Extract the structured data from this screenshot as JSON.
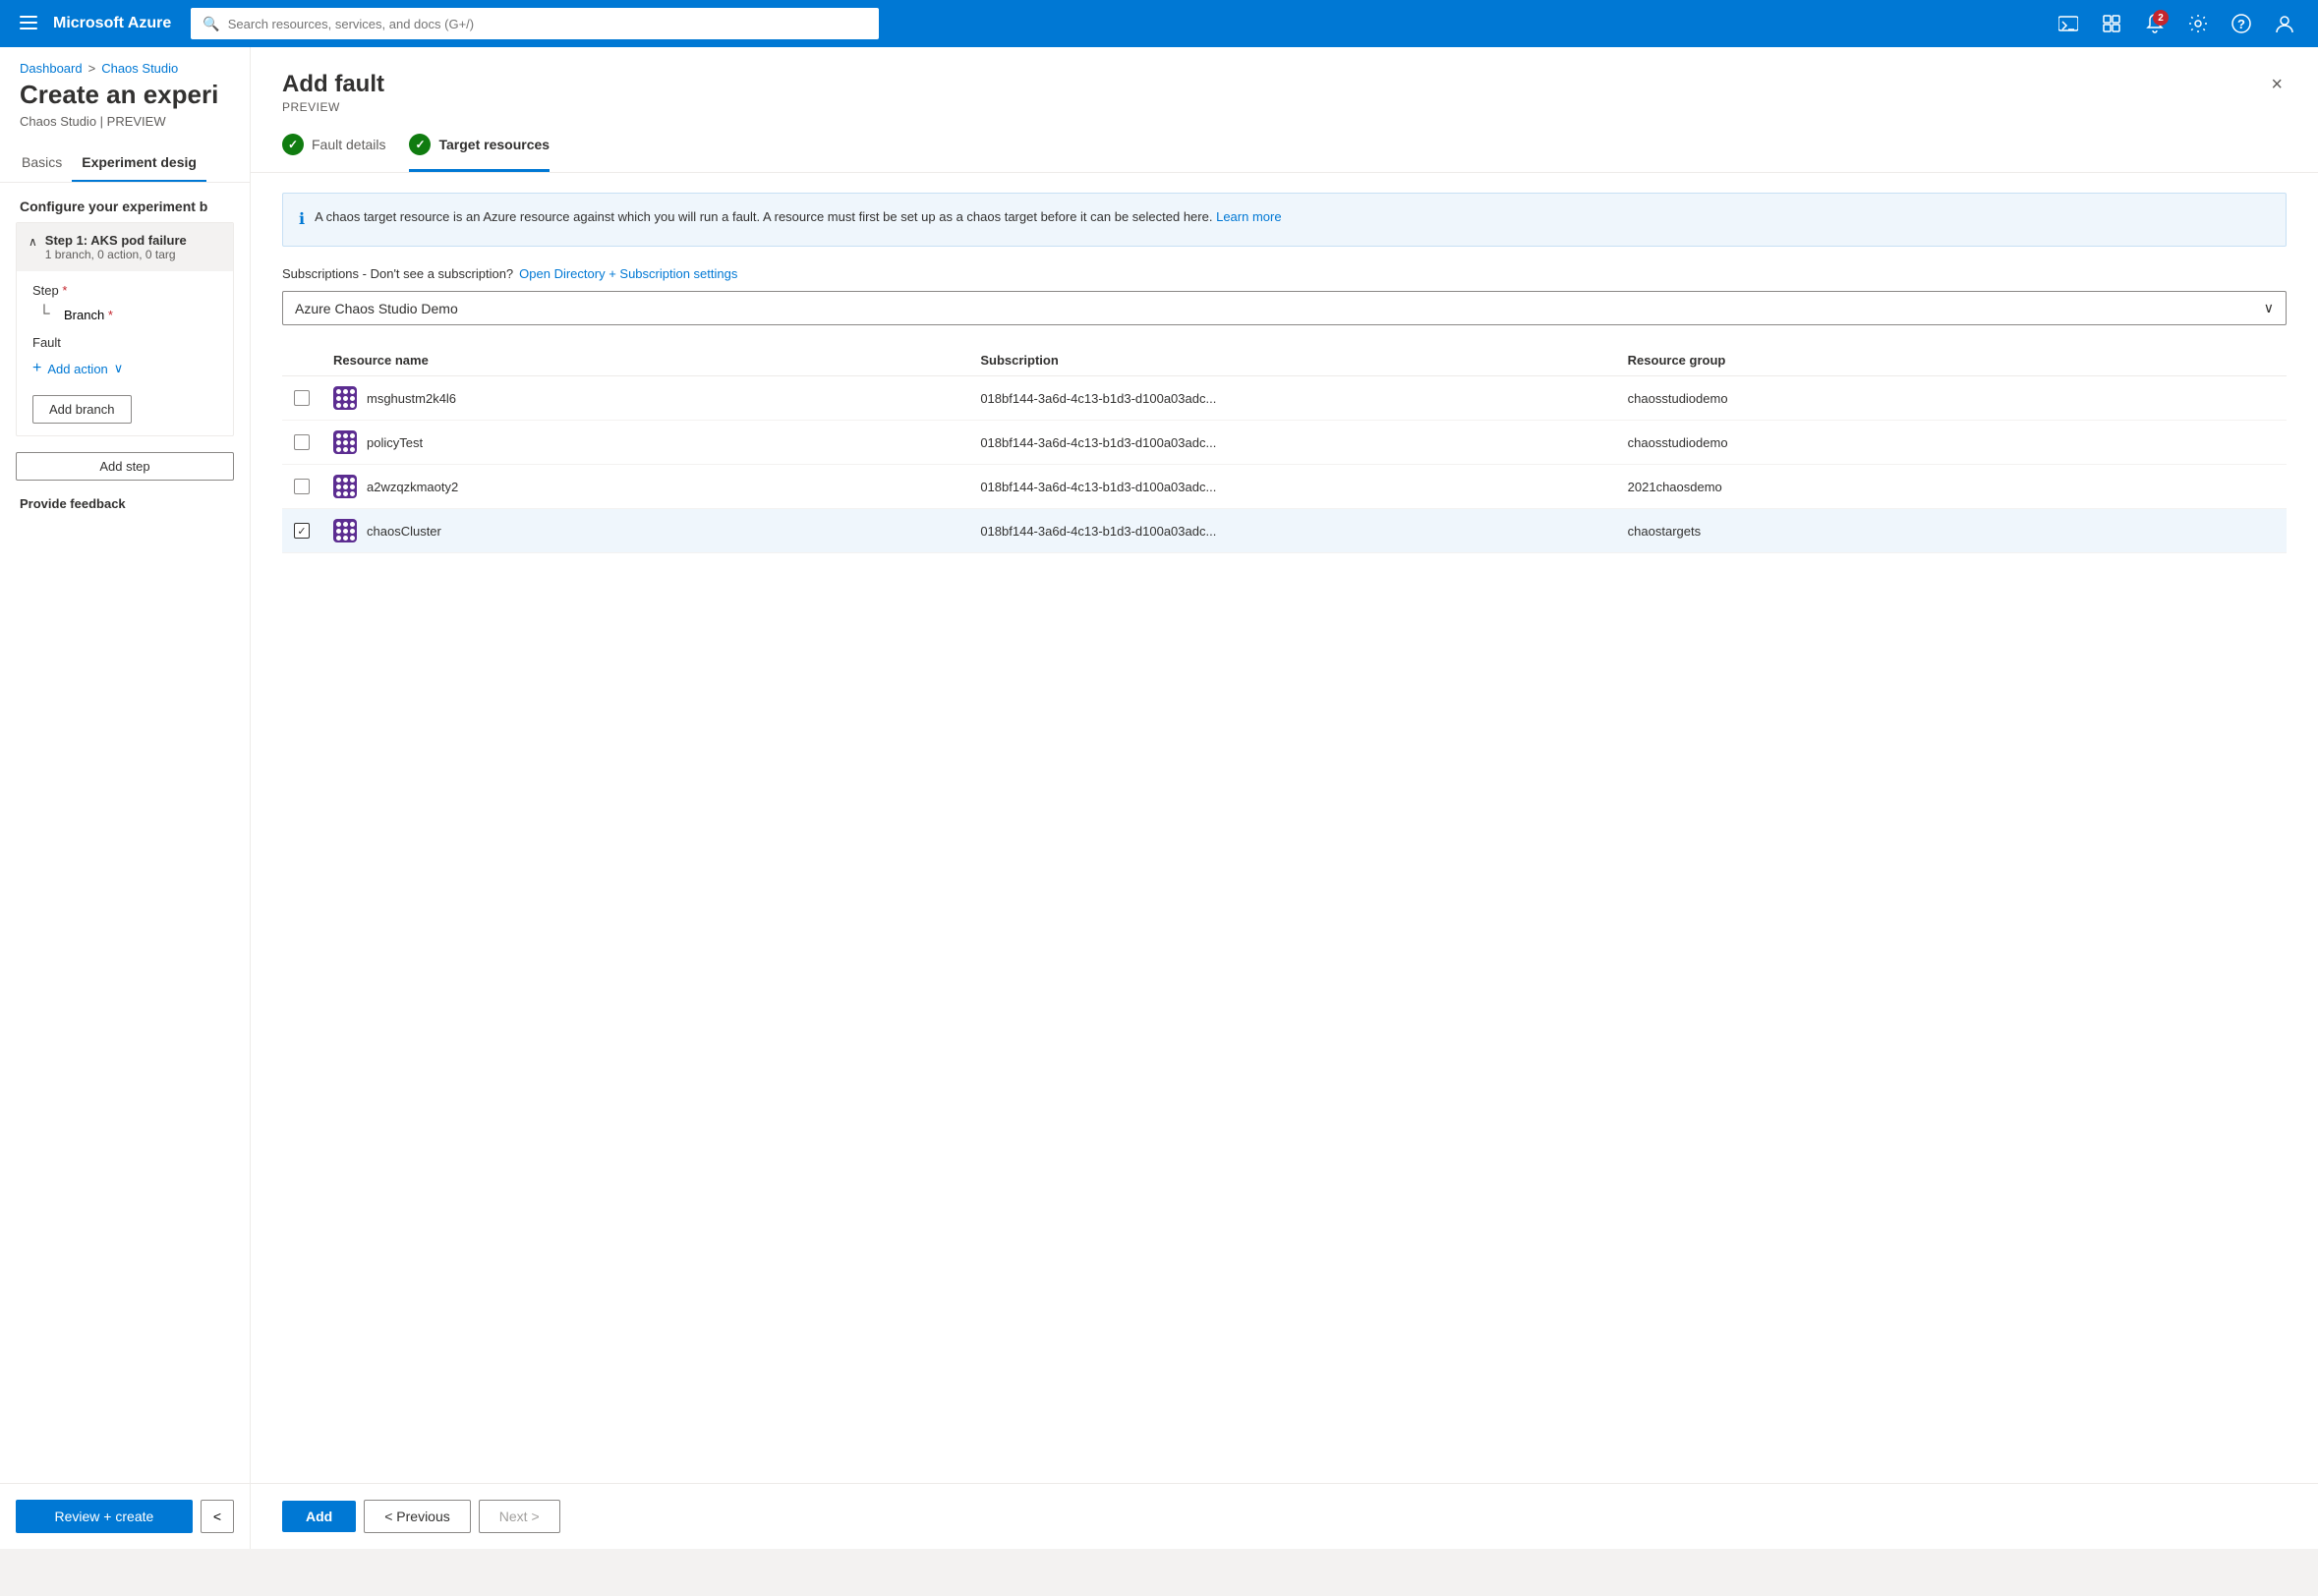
{
  "topbar": {
    "brand": "Microsoft Azure",
    "search_placeholder": "Search resources, services, and docs (G+/)",
    "notification_count": "2"
  },
  "left_panel": {
    "breadcrumb": {
      "dashboard": "Dashboard",
      "separator": ">",
      "chaos_studio": "Chaos Studio"
    },
    "page_title": "Create an experi",
    "page_subtitle": "Chaos Studio | PREVIEW",
    "tabs": [
      {
        "id": "basics",
        "label": "Basics"
      },
      {
        "id": "experiment-design",
        "label": "Experiment desig",
        "active": true
      }
    ],
    "configure_label": "Configure your experiment b",
    "step": {
      "title": "Step 1: AKS pod failure",
      "meta": "1 branch, 0 action, 0 targ",
      "step_label": "Step",
      "branch_label": "Branch",
      "fault_label": "Fault",
      "add_action_label": "Add action",
      "add_branch_label": "Add branch",
      "add_step_label": "Add step"
    },
    "provide_feedback": "Provide feedback",
    "bottom_bar": {
      "review_create": "Review + create",
      "left_arrow": "<"
    }
  },
  "dialog": {
    "title": "Add fault",
    "subtitle": "PREVIEW",
    "close_label": "×",
    "wizard_steps": [
      {
        "id": "fault-details",
        "label": "Fault details",
        "completed": true
      },
      {
        "id": "target-resources",
        "label": "Target resources",
        "active": true,
        "completed": true
      }
    ],
    "info_box": {
      "text": "A chaos target resource is an Azure resource against which you will run a fault. A resource must first be set up as a chaos target before it can be selected here.",
      "link_text": "Learn more"
    },
    "subscriptions": {
      "label": "Subscriptions - Don't see a subscription?",
      "link_text": "Open Directory + Subscription settings",
      "selected": "Azure Chaos Studio Demo"
    },
    "table": {
      "headers": [
        "",
        "Resource name",
        "Subscription",
        "Resource group"
      ],
      "rows": [
        {
          "selected": false,
          "name": "msghustm2k4l6",
          "subscription": "018bf144-3a6d-4c13-b1d3-d100a03adc...",
          "resource_group": "chaosstudiodemo"
        },
        {
          "selected": false,
          "name": "policyTest",
          "subscription": "018bf144-3a6d-4c13-b1d3-d100a03adc...",
          "resource_group": "chaosstudiodemo"
        },
        {
          "selected": false,
          "name": "a2wzqzkmaoty2",
          "subscription": "018bf144-3a6d-4c13-b1d3-d100a03adc...",
          "resource_group": "2021chaosdemo"
        },
        {
          "selected": true,
          "name": "chaosCluster",
          "subscription": "018bf144-3a6d-4c13-b1d3-d100a03adc...",
          "resource_group": "chaostargets"
        }
      ]
    },
    "footer": {
      "add_label": "Add",
      "previous_label": "< Previous",
      "next_label": "Next >"
    }
  }
}
